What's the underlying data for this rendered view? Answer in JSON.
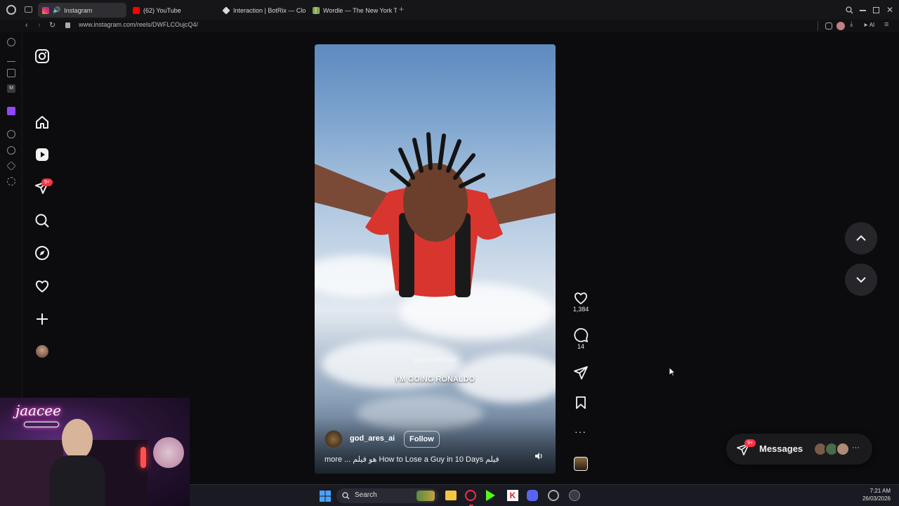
{
  "browser": {
    "tabs": [
      {
        "label": "Instagram",
        "active": true
      },
      {
        "label": "(62) YouTube",
        "active": false
      },
      {
        "label": "Interaction | BotRix — Clo",
        "active": false
      },
      {
        "label": "Wordle — The New York T",
        "active": false
      }
    ],
    "url": "www.instagram.com/reels/DWFLCOujcQ4/",
    "ai_label": "AI"
  },
  "instagram": {
    "nav_badge": "9+",
    "reel": {
      "watermark": "@GODARESAI",
      "caption_overlay": "I'M GOING RONALDO",
      "username": "god_ares_ai",
      "follow_label": "Follow",
      "description": "more ... هو فيلم How to Lose a Guy in 10 Days فيلم"
    },
    "actions": {
      "likes": "1,384",
      "comments": "14"
    },
    "messages": {
      "label": "Messages",
      "badge": "9+"
    }
  },
  "webcam": {
    "overlay_text": "jaacee"
  },
  "taskbar": {
    "search_label": "Search",
    "time": "7:21 AM",
    "date": "26/03/2026"
  },
  "colors": {
    "accent_red": "#ff3040",
    "tab_active": "#2f2f33",
    "background": "#0c0c0e"
  }
}
